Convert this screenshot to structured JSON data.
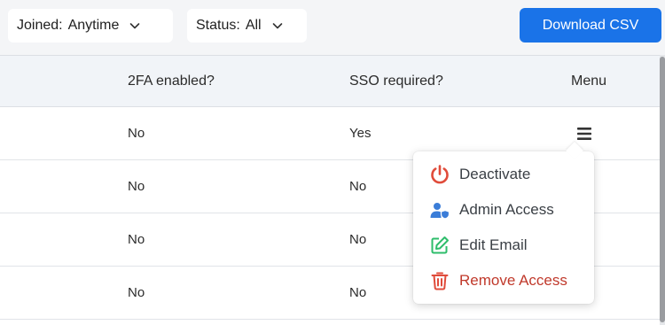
{
  "filters": {
    "joined": {
      "label": "Joined:",
      "value": "Anytime"
    },
    "status": {
      "label": "Status:",
      "value": "All"
    }
  },
  "download_button": "Download CSV",
  "table": {
    "headers": {
      "twofa": "2FA enabled?",
      "sso": "SSO required?",
      "menu": "Menu"
    },
    "rows": [
      {
        "twofa": "No",
        "sso": "Yes"
      },
      {
        "twofa": "No",
        "sso": "No"
      },
      {
        "twofa": "No",
        "sso": "No"
      },
      {
        "twofa": "No",
        "sso": "No"
      }
    ]
  },
  "row_menu": {
    "items": [
      {
        "label": "Deactivate",
        "icon": "power-icon"
      },
      {
        "label": "Admin Access",
        "icon": "user-shield-icon"
      },
      {
        "label": "Edit Email",
        "icon": "edit-icon"
      },
      {
        "label": "Remove Access",
        "icon": "trash-icon"
      }
    ]
  },
  "colors": {
    "primary": "#1a73e8",
    "danger": "#e04b3a",
    "admin": "#3b7dd8",
    "edit": "#2ebd6b"
  }
}
